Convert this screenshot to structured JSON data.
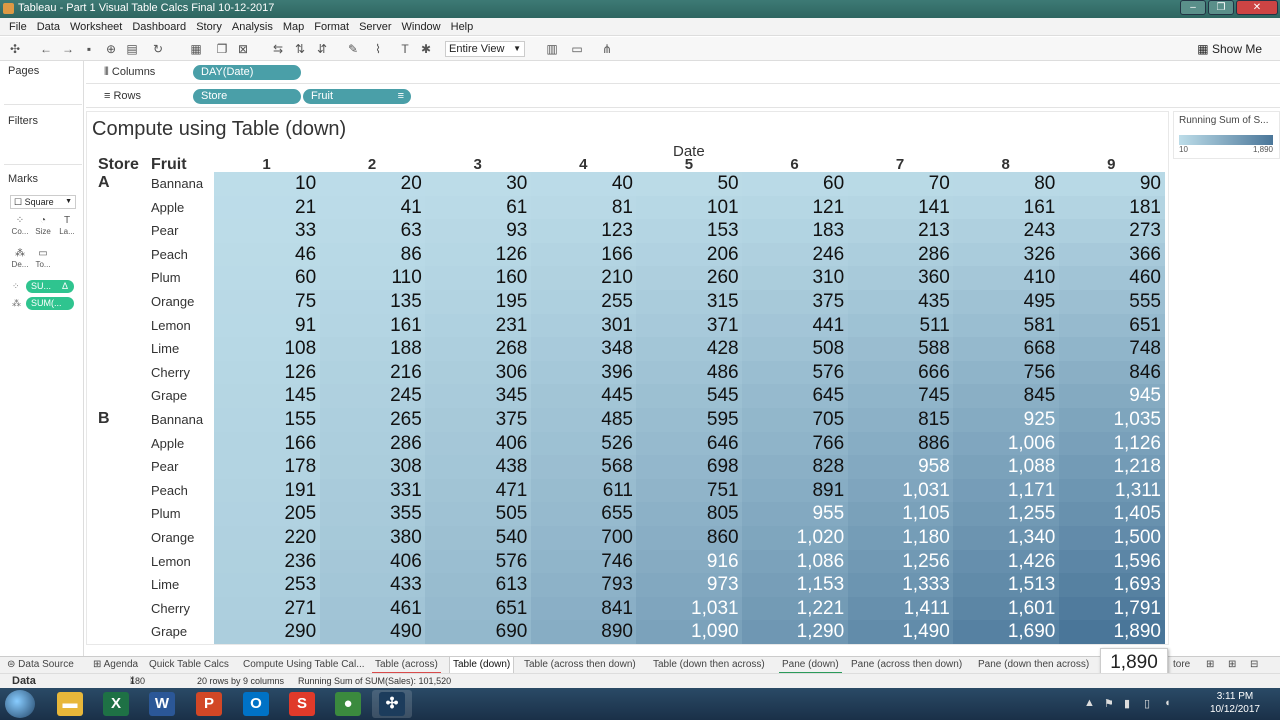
{
  "window": {
    "title": "Tableau - Part 1 Visual Table Calcs Final 10-12-2017"
  },
  "menu": [
    "File",
    "Data",
    "Worksheet",
    "Dashboard",
    "Story",
    "Analysis",
    "Map",
    "Format",
    "Server",
    "Window",
    "Help"
  ],
  "toolbar": {
    "view_select": "Entire View",
    "show_me": "Show Me"
  },
  "cards": {
    "pages": "Pages",
    "filters": "Filters",
    "marks": "Marks",
    "mark_type": "Square"
  },
  "mark_buttons": [
    {
      "label": "Co...",
      "icon": "color-icon"
    },
    {
      "label": "Size",
      "icon": "size-icon"
    },
    {
      "label": "La...",
      "icon": "label-icon"
    },
    {
      "label": "De...",
      "icon": "detail-icon"
    },
    {
      "label": "To...",
      "icon": "tooltip-icon"
    }
  ],
  "mark_pills": [
    "SU...",
    "SUM(..."
  ],
  "mark_pill_delta": "Δ",
  "shelves": {
    "columns_label": "Columns",
    "rows_label": "Rows",
    "columns_pill": "DAY(Date)",
    "rows_pills": [
      "Store",
      "Fruit"
    ]
  },
  "sheet": {
    "title": "Compute using Table (down)",
    "date_header": "Date",
    "store_header": "Store",
    "fruit_header": "Fruit"
  },
  "table": {
    "columns": [
      "1",
      "2",
      "3",
      "4",
      "5",
      "6",
      "7",
      "8",
      "9"
    ],
    "stores": [
      "A",
      "B"
    ],
    "fruits": [
      "Bannana",
      "Apple",
      "Pear",
      "Peach",
      "Plum",
      "Orange",
      "Lemon",
      "Lime",
      "Cherry",
      "Grape"
    ],
    "values": [
      [
        10,
        20,
        30,
        40,
        50,
        60,
        70,
        80,
        90
      ],
      [
        21,
        41,
        61,
        81,
        101,
        121,
        141,
        161,
        181
      ],
      [
        33,
        63,
        93,
        123,
        153,
        183,
        213,
        243,
        273
      ],
      [
        46,
        86,
        126,
        166,
        206,
        246,
        286,
        326,
        366
      ],
      [
        60,
        110,
        160,
        210,
        260,
        310,
        360,
        410,
        460
      ],
      [
        75,
        135,
        195,
        255,
        315,
        375,
        435,
        495,
        555
      ],
      [
        91,
        161,
        231,
        301,
        371,
        441,
        511,
        581,
        651
      ],
      [
        108,
        188,
        268,
        348,
        428,
        508,
        588,
        668,
        748
      ],
      [
        126,
        216,
        306,
        396,
        486,
        576,
        666,
        756,
        846
      ],
      [
        145,
        245,
        345,
        445,
        545,
        645,
        745,
        845,
        945
      ],
      [
        155,
        265,
        375,
        485,
        595,
        705,
        815,
        925,
        1035
      ],
      [
        166,
        286,
        406,
        526,
        646,
        766,
        886,
        1006,
        1126
      ],
      [
        178,
        308,
        438,
        568,
        698,
        828,
        958,
        1088,
        1218
      ],
      [
        191,
        331,
        471,
        611,
        751,
        891,
        1031,
        1171,
        1311
      ],
      [
        205,
        355,
        505,
        655,
        805,
        955,
        1105,
        1255,
        1405
      ],
      [
        220,
        380,
        540,
        700,
        860,
        1020,
        1180,
        1340,
        1500
      ],
      [
        236,
        406,
        576,
        746,
        916,
        1086,
        1256,
        1426,
        1596
      ],
      [
        253,
        433,
        613,
        793,
        973,
        1153,
        1333,
        1513,
        1693
      ],
      [
        271,
        461,
        651,
        841,
        1031,
        1221,
        1411,
        1601,
        1791
      ],
      [
        290,
        490,
        690,
        890,
        1090,
        1290,
        1490,
        1690,
        1890
      ]
    ],
    "color_min": 10,
    "color_max": 1890,
    "color_low": "#bddde9",
    "color_high": "#4a7699",
    "text_flip_threshold": 900
  },
  "legend": {
    "title": "Running Sum of S...",
    "min_label": "10",
    "max_label": "1,890"
  },
  "tooltip": {
    "value": "1,890"
  },
  "tabs": [
    {
      "label": "Data Source",
      "icon": "datasource-icon"
    },
    {
      "label": "Agenda",
      "icon": "grid-icon"
    },
    {
      "label": "Quick Table Calcs"
    },
    {
      "label": "Compute Using Table Cal..."
    },
    {
      "label": "Table (across)"
    },
    {
      "label": "Table (down)"
    },
    {
      "label": "Table (across then down)"
    },
    {
      "label": "Table (down then across)"
    },
    {
      "label": "Pane (down)"
    },
    {
      "label": "Pane (across then down)"
    },
    {
      "label": "Pane (down then across)"
    },
    {
      "label": "tore"
    }
  ],
  "status": {
    "data": "Data",
    "marks": "180 marks",
    "rows_cols": "20 rows by 9 columns",
    "sum": "Running Sum of SUM(Sales): 101,520"
  },
  "taskbar": {
    "apps": [
      {
        "name": "folder-app",
        "glyph": "▬",
        "color": "#e8b73a"
      },
      {
        "name": "excel-app",
        "glyph": "X",
        "color": "#1e7145"
      },
      {
        "name": "word-app",
        "glyph": "W",
        "color": "#2b5797"
      },
      {
        "name": "powerpoint-app",
        "glyph": "P",
        "color": "#d24726"
      },
      {
        "name": "outlook-app",
        "glyph": "O",
        "color": "#0072c6"
      },
      {
        "name": "snagit-app",
        "glyph": "S",
        "color": "#e03a2a"
      },
      {
        "name": "chrome-app",
        "glyph": "●",
        "color": "#3b8a3e"
      },
      {
        "name": "tableau-app",
        "glyph": "✣",
        "color": "#1c3c5c"
      }
    ],
    "time": "3:11 PM",
    "date": "10/12/2017"
  }
}
